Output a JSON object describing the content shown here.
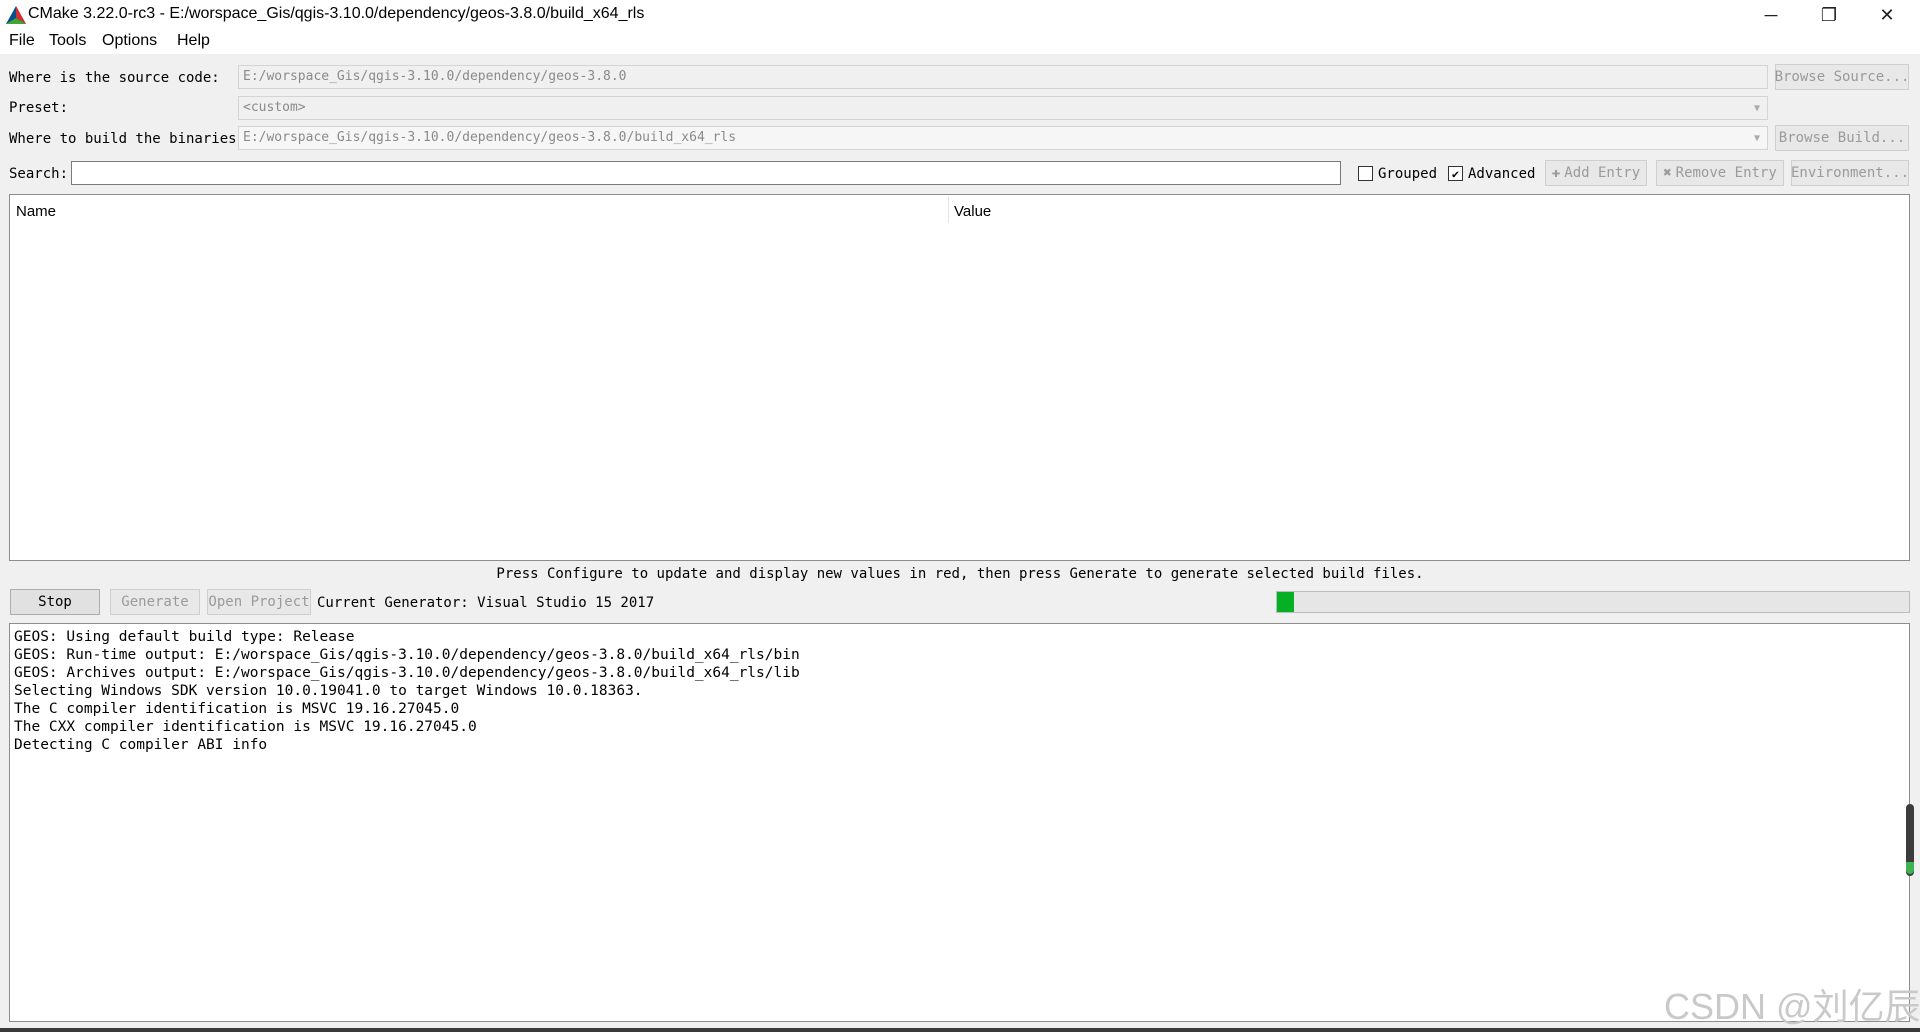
{
  "window": {
    "title": "CMake 3.22.0-rc3 - E:/worspace_Gis/qgis-3.10.0/dependency/geos-3.8.0/build_x64_rls",
    "controls": {
      "minimize": "─",
      "maximize": "❐",
      "close": "✕"
    }
  },
  "menu": [
    "File",
    "Tools",
    "Options",
    "Help"
  ],
  "source": {
    "label": "Where is the source code:",
    "value": "E:/worspace_Gis/qgis-3.10.0/dependency/geos-3.8.0",
    "button": "Browse Source..."
  },
  "preset": {
    "label": "Preset:",
    "value": "<custom>"
  },
  "build": {
    "label": "Where to build the binaries:",
    "value": "E:/worspace_Gis/qgis-3.10.0/dependency/geos-3.8.0/build_x64_rls",
    "button": "Browse Build..."
  },
  "search": {
    "label": "Search:",
    "value": "",
    "grouped_label": "Grouped",
    "grouped_checked": false,
    "advanced_label": "Advanced",
    "advanced_checked": true,
    "add_entry": "Add Entry",
    "remove_entry": "Remove Entry",
    "environment": "Environment..."
  },
  "table": {
    "columns": [
      "Name",
      "Value"
    ]
  },
  "hint": "Press Configure to update and display new values in red, then press Generate to generate selected build files.",
  "actions": {
    "stop": "Stop",
    "generate": "Generate",
    "open_project": "Open Project",
    "generator": "Current Generator: Visual Studio 15 2017"
  },
  "progress": {
    "value_fraction": 0.01
  },
  "output_lines": [
    "GEOS: Using default build type: Release",
    "GEOS: Run-time output: E:/worspace_Gis/qgis-3.10.0/dependency/geos-3.8.0/build_x64_rls/bin",
    "GEOS: Archives output: E:/worspace_Gis/qgis-3.10.0/dependency/geos-3.8.0/build_x64_rls/lib",
    "Selecting Windows SDK version 10.0.19041.0 to target Windows 10.0.18363.",
    "The C compiler identification is MSVC 19.16.27045.0",
    "The CXX compiler identification is MSVC 19.16.27045.0",
    "Detecting C compiler ABI info"
  ],
  "watermark": "CSDN @刘亿辰",
  "colors": {
    "progress": "#06b025",
    "accent": "#0078d7"
  }
}
